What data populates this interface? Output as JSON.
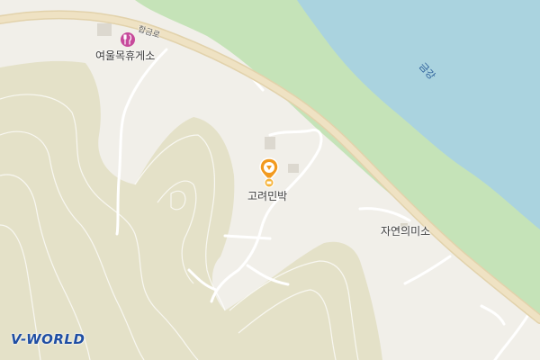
{
  "map": {
    "colors": {
      "land": "#f1efe9",
      "forest": "#e4e1c8",
      "contour": "#ffffff",
      "river": "#aad3df",
      "riverbank": "#c5e3b8",
      "road": "#efe2c3",
      "road_edge": "#e2d2ab",
      "path": "#ffffff",
      "poi_pin": "#f29a1f",
      "food_pin": "#c74a9b",
      "brand": "#1f4ea3"
    },
    "labels": {
      "rest_area": "여울목휴게소",
      "road_name": "합금로",
      "river": "금강",
      "pension": "고려민박",
      "memorial": "자연의미소"
    },
    "icons": {
      "rest_area": "restaurant-icon",
      "pension": "lodging-pin-icon",
      "memorial": "building-icon"
    },
    "brand": {
      "logo_text": "V-WORLD"
    }
  }
}
